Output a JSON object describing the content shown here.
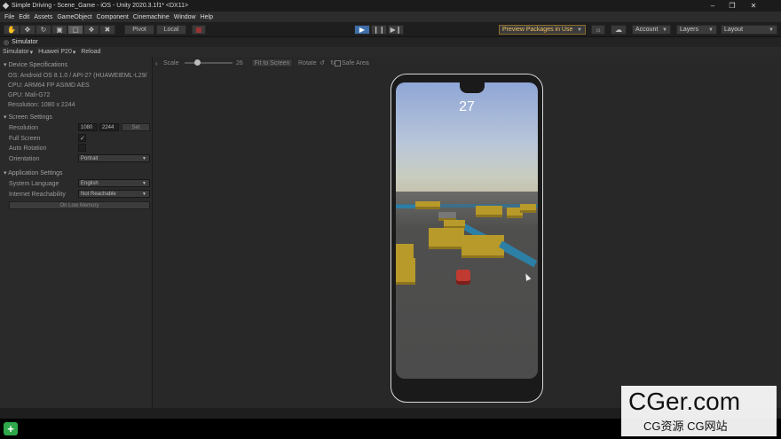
{
  "window": {
    "title": "Simple Driving - Scene_Game - iOS - Unity 2020.3.1f1* <DX11>"
  },
  "menu": [
    "File",
    "Edit",
    "Assets",
    "GameObject",
    "Component",
    "Cinemachine",
    "Window",
    "Help"
  ],
  "toolbar": {
    "pivot_label": "Pivot",
    "local_label": "Local",
    "preview_packages": "Preview Packages in Use",
    "account": "Account",
    "layers": "Layers",
    "layout": "Layout"
  },
  "simulator": {
    "tab": "Simulator",
    "view_mode": "Simulator",
    "device": "Huawei P20",
    "reload": "Reload"
  },
  "device_specs": {
    "title": "Device Specifications",
    "os": "OS: Android OS 8.1.0 / API-27 (HUAWEIEML-L29/",
    "cpu": "CPU: ARM64 FP ASIMD AES",
    "gpu": "GPU: Mali-G72",
    "resolution": "Resolution: 1080 x 2244"
  },
  "screen_settings": {
    "title": "Screen Settings",
    "resolution_label": "Resolution",
    "res_w": "1080",
    "res_h": "2244",
    "set_label": "Set",
    "full_screen_label": "Full Screen",
    "auto_rotation_label": "Auto Rotation",
    "orientation_label": "Orientation",
    "orientation_value": "Portrait"
  },
  "app_settings": {
    "title": "Application Settings",
    "language_label": "System Language",
    "language_value": "English",
    "reach_label": "Internet Reachability",
    "reach_value": "Not Reachable",
    "low_memory": "On Low Memory"
  },
  "view_toolbar": {
    "scale_label": "Scale",
    "scale_value": "26",
    "scale_fraction": 0.27,
    "fit_label": "Fit to Screen",
    "rotate_label": "Rotate",
    "safe_area_label": "Safe Area"
  },
  "game": {
    "score": "27"
  },
  "watermark": {
    "line1": "CGer.com",
    "line2": "CG资源 CG网站"
  }
}
